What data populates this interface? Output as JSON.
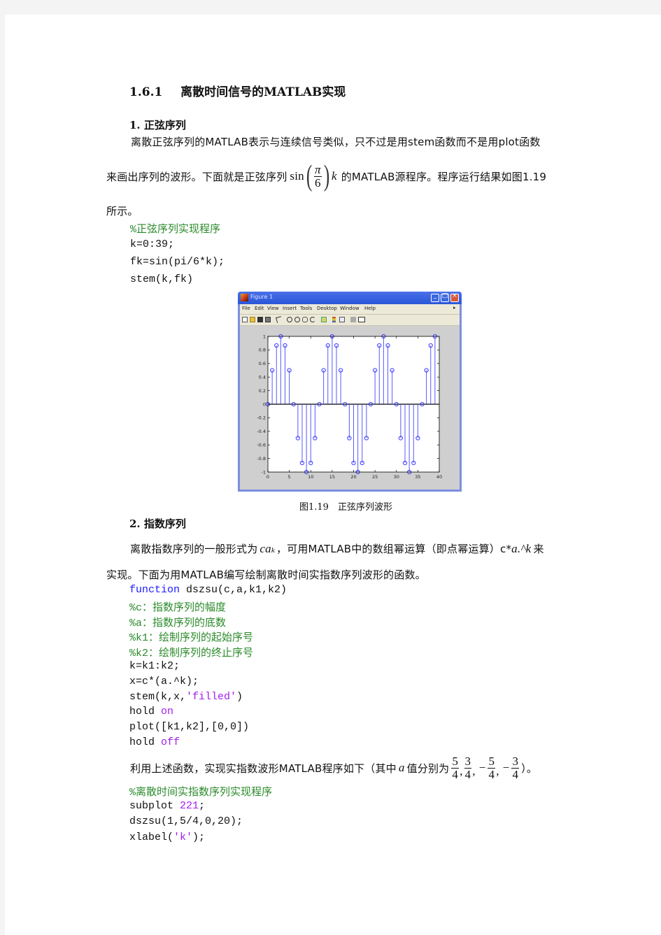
{
  "section": {
    "number": "1.6.1",
    "title": "离散时间信号的MATLAB实现"
  },
  "subsection1": {
    "heading": "1. 正弦序列",
    "para_line1": "离散正弦序列的MATLAB表示与连续信号类似，只不过是用stem函数而不是用plot函数",
    "para_line2_before": "来画出序列的波形。下面就是正弦序列",
    "math_sin": "sin",
    "math_pi": "π",
    "math_den": "6",
    "math_k": "k",
    "para_line2_after": "的MATLAB源程序。程序运行结果如图1.19",
    "para_line3": "所示。",
    "code": [
      {
        "type": "comment",
        "text": "%正弦序列实现程序"
      },
      {
        "type": "plain",
        "text": "k=0:39;"
      },
      {
        "type": "plain",
        "text": "fk=sin(pi/6*k);"
      },
      {
        "type": "plain",
        "text": "stem(k,fk)"
      }
    ]
  },
  "figure_window": {
    "title": "Figure 1",
    "menus": [
      "File",
      "Edit",
      "View",
      "Insert",
      "Tools",
      "Desktop",
      "Window",
      "Help"
    ],
    "toolbar_icons": [
      "new-file-icon",
      "open-folder-icon",
      "save-icon",
      "print-icon",
      "pointer-icon",
      "zoom-in-icon",
      "zoom-out-icon",
      "pan-hand-icon",
      "rotate-icon",
      "data-cursor-icon",
      "colorbar-icon",
      "legend-icon",
      "hide-plot-tools-icon",
      "show-plot-tools-icon"
    ],
    "window_buttons": {
      "minimize": "_",
      "maximize": "□",
      "close": "×"
    }
  },
  "chart_data": {
    "type": "stem",
    "title": "",
    "xlabel": "",
    "ylabel": "",
    "xlim": [
      0,
      40
    ],
    "ylim": [
      -1,
      1
    ],
    "xticks": [
      0,
      5,
      10,
      15,
      20,
      25,
      30,
      35,
      40
    ],
    "yticks": [
      -1,
      -0.8,
      -0.6,
      -0.4,
      -0.2,
      0,
      0.2,
      0.4,
      0.6,
      0.8,
      1
    ],
    "xtick_labels": [
      "0",
      "5",
      "10",
      "15",
      "20",
      "25",
      "30",
      "35",
      "40"
    ],
    "ytick_labels": [
      "-1",
      "-0.8",
      "-0.6",
      "-0.4",
      "-0.2",
      "0",
      "0.2",
      "0.4",
      "0.6",
      "0.8",
      "1"
    ],
    "grid": false,
    "series": [
      {
        "name": "fk=sin(pi/6*k)",
        "color": "#3b3bff",
        "x": [
          0,
          1,
          2,
          3,
          4,
          5,
          6,
          7,
          8,
          9,
          10,
          11,
          12,
          13,
          14,
          15,
          16,
          17,
          18,
          19,
          20,
          21,
          22,
          23,
          24,
          25,
          26,
          27,
          28,
          29,
          30,
          31,
          32,
          33,
          34,
          35,
          36,
          37,
          38,
          39
        ],
        "values": [
          0,
          0.5,
          0.866,
          1,
          0.866,
          0.5,
          0,
          -0.5,
          -0.866,
          -1,
          -0.866,
          -0.5,
          0,
          0.5,
          0.866,
          1,
          0.866,
          0.5,
          0,
          -0.5,
          -0.866,
          -1,
          -0.866,
          -0.5,
          0,
          0.5,
          0.866,
          1,
          0.866,
          0.5,
          0,
          -0.5,
          -0.866,
          -1,
          -0.866,
          -0.5,
          0,
          0.5,
          0.866,
          1
        ]
      }
    ]
  },
  "figure_caption": "图1.19　正弦序列波形",
  "subsection2": {
    "heading": "2. 指数序列",
    "para_line1_before": "离散指数序列的一般形式为",
    "math_cak_c": "ca",
    "math_cak_sup": "k",
    "para_line1_mid": "，可用MATLAB中的数组幂运算（即点幂运算）c*",
    "math_ak": "a.^k",
    "para_line1_after": "来",
    "para_line2": "实现。下面为用MATLAB编写绘制离散时间实指数序列波形的函数。",
    "code": [
      [
        {
          "cls": "kw",
          "text": "function"
        },
        {
          "cls": "",
          "text": " dszsu(c,a,k1,k2)"
        }
      ],
      [
        {
          "cls": "cmt",
          "text": "%c：指数序列的幅度"
        }
      ],
      [
        {
          "cls": "cmt",
          "text": "%a：指数序列的底数"
        }
      ],
      [
        {
          "cls": "cmt",
          "text": "%k1：绘制序列的起始序号"
        }
      ],
      [
        {
          "cls": "cmt",
          "text": "%k2：绘制序列的终止序号"
        }
      ],
      [
        {
          "cls": "",
          "text": "k=k1:k2;"
        }
      ],
      [
        {
          "cls": "",
          "text": "x=c*(a.^k);"
        }
      ],
      [
        {
          "cls": "",
          "text": "stem(k,x,"
        },
        {
          "cls": "str",
          "text": "'filled'"
        },
        {
          "cls": "",
          "text": ")"
        }
      ],
      [
        {
          "cls": "",
          "text": "hold "
        },
        {
          "cls": "str",
          "text": "on"
        }
      ],
      [
        {
          "cls": "",
          "text": "plot([k1,k2],[0,0])"
        }
      ],
      [
        {
          "cls": "",
          "text": "hold "
        },
        {
          "cls": "str",
          "text": "off"
        }
      ]
    ],
    "para2_before": "利用上述函数，实现实指数波形MATLAB程序如下（其中",
    "para2_a": "a",
    "para2_mid": "值分别为",
    "fractions": [
      {
        "sign": "",
        "num": "5",
        "den": "4"
      },
      {
        "sign": "",
        "num": "3",
        "den": "4"
      },
      {
        "sign": "−",
        "num": "5",
        "den": "4"
      },
      {
        "sign": "−",
        "num": "3",
        "den": "4"
      }
    ],
    "para2_after": "）。",
    "code2": [
      [
        {
          "cls": "cmt",
          "text": "%离散时间实指数序列实现程序"
        }
      ],
      [
        {
          "cls": "",
          "text": "subplot "
        },
        {
          "cls": "num",
          "text": "221"
        },
        {
          "cls": "",
          "text": ";"
        }
      ],
      [
        {
          "cls": "",
          "text": "dszsu(1,5/4,0,20);"
        }
      ],
      [
        {
          "cls": "",
          "text": "xlabel("
        },
        {
          "cls": "str",
          "text": "'k'"
        },
        {
          "cls": "",
          "text": ");"
        }
      ]
    ]
  }
}
